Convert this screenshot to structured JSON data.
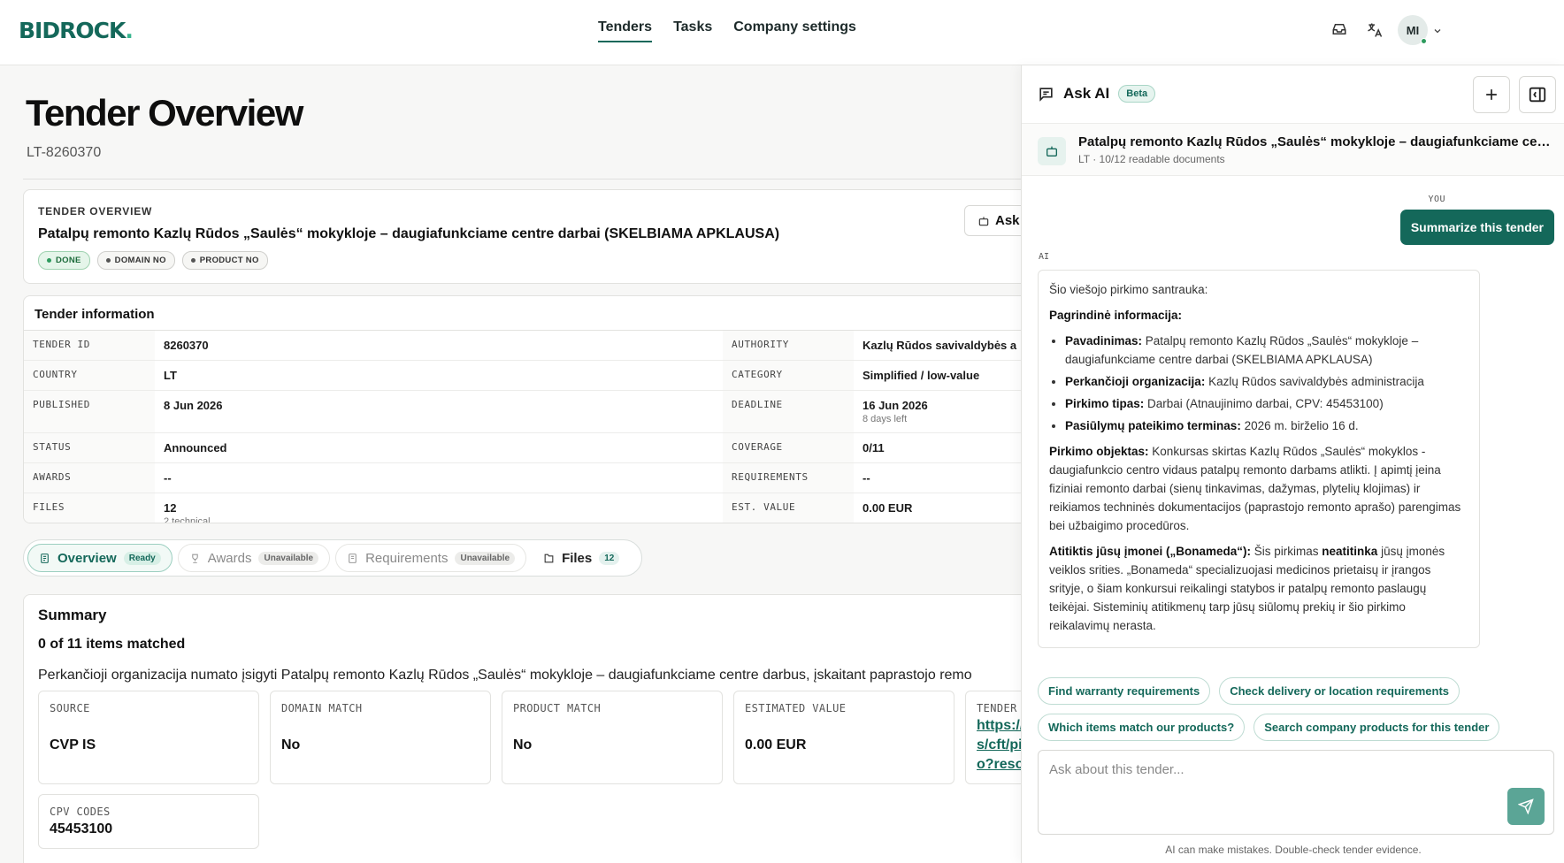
{
  "header": {
    "logo_main": "BIDROCK",
    "logo_dot": ".",
    "nav": [
      "Tenders",
      "Tasks",
      "Company settings"
    ],
    "avatar_initials": "MI"
  },
  "page": {
    "title": "Tender Overview",
    "subtitle": "LT-8260370"
  },
  "overview_card": {
    "eyebrow": "TENDER OVERVIEW",
    "title": "Patalpų remonto Kazlų Rūdos „Saulės“ mokykloje – daugiafunkciame centre darbai (SKELBIAMA APKLAUSA)",
    "badges": [
      "DONE",
      "DOMAIN NO",
      "PRODUCT NO"
    ],
    "ask_button": "Ask"
  },
  "info": {
    "heading": "Tender information",
    "rows": [
      {
        "k1": "TENDER ID",
        "v1": "8260370",
        "s1": "",
        "k2": "AUTHORITY",
        "v2": "Kazlų Rūdos savivaldybės a",
        "s2": ""
      },
      {
        "k1": "COUNTRY",
        "v1": "LT",
        "s1": "",
        "k2": "CATEGORY",
        "v2": "Simplified / low-value",
        "s2": ""
      },
      {
        "k1": "PUBLISHED",
        "v1": "8 Jun 2026",
        "s1": "",
        "k2": "DEADLINE",
        "v2": "16 Jun 2026",
        "s2": "8 days left"
      },
      {
        "k1": "STATUS",
        "v1": "Announced",
        "s1": "",
        "k2": "COVERAGE",
        "v2": "0/11",
        "s2": ""
      },
      {
        "k1": "AWARDS",
        "v1": "--",
        "s1": "",
        "k2": "REQUIREMENTS",
        "v2": "--",
        "s2": ""
      },
      {
        "k1": "FILES",
        "v1": "12",
        "s1": "2 technical",
        "k2": "EST. VALUE",
        "v2": "0.00 EUR",
        "s2": ""
      }
    ]
  },
  "tabs": [
    {
      "label": "Overview",
      "pill": "Ready"
    },
    {
      "label": "Awards",
      "pill": "Unavailable"
    },
    {
      "label": "Requirements",
      "pill": "Unavailable"
    },
    {
      "label": "Files",
      "pill": "12"
    }
  ],
  "summary": {
    "title": "Summary",
    "count": "0 of 11 items matched",
    "description": "Perkančioji organizacija numato įsigyti Patalpų remonto Kazlų Rūdos „Saulės“ mokykloje – daugiafunkciame centre darbus, įskaitant paprastojo remo",
    "cards": [
      {
        "key": "SOURCE",
        "value": "CVP IS"
      },
      {
        "key": "DOMAIN MATCH",
        "value": "No"
      },
      {
        "key": "PRODUCT MATCH",
        "value": "No"
      },
      {
        "key": "ESTIMATED VALUE",
        "value": "0.00 EUR"
      },
      {
        "key": "TENDER",
        "value": "https://\ns/cft/pi\no?reso"
      }
    ],
    "cpv_key": "CPV CODES",
    "cpv_value": "45453100"
  },
  "ai": {
    "title": "Ask AI",
    "beta": "Beta",
    "context_title": "Patalpų remonto Kazlų Rūdos „Saulės“ mokykloje – daugiafunkciame centre darbai (SKELBIAMA APKLAUSA)",
    "context_sub": "LT · 10/12 readable documents",
    "you_label": "YOU",
    "you_message": "Summarize this tender",
    "ai_label": "AI",
    "answer": {
      "intro": "Šio viešojo pirkimo santrauka:",
      "main_heading": "Pagrindinė informacija:",
      "bullets": [
        {
          "b": "Pavadinimas:",
          "t": " Patalpų remonto Kazlų Rūdos „Saulės“ mokykloje – daugiafunkciame centre darbai (SKELBIAMA APKLAUSA)"
        },
        {
          "b": "Perkančioji organizacija:",
          "t": " Kazlų Rūdos savivaldybės administracija"
        },
        {
          "b": "Pirkimo tipas:",
          "t": " Darbai (Atnaujinimo darbai, CPV: 45453100)"
        },
        {
          "b": "Pasiūlymų pateikimo terminas:",
          "t": " 2026 m. birželio 16 d."
        }
      ],
      "object_b": "Pirkimo objektas:",
      "object_t": " Konkursas skirtas Kazlų Rūdos „Saulės“ mokyklos - daugiafunkcio centro vidaus patalpų remonto darbams atlikti. Į apimtį įeina fiziniai remonto darbai (sienų tinkavimas, dažymas, plytelių klojimas) ir reikiamos techninės dokumentacijos (paprastojo remonto aprašo) parengimas bei užbaigimo procedūros.",
      "fit_b": "Atitiktis jūsų įmonei („Bonameda“):",
      "fit_t1": " Šis pirkimas ",
      "fit_b2": "neatitinka",
      "fit_t2": " jūsų įmonės veiklos srities. „Bonameda“ specializuojasi medicinos prietaisų ir įrangos srityje, o šiam konkursui reikalingi statybos ir patalpų remonto paslaugų teikėjai. Sisteminių atitikmenų tarp jūsų siūlomų prekių ir šio pirkimo reikalavimų nerasta."
    },
    "chips": [
      "Find warranty requirements",
      "Check delivery or location requirements",
      "Which items match our products?",
      "Search company products for this tender"
    ],
    "input_placeholder": "Ask about this tender...",
    "disclaimer": "AI can make mistakes. Double-check tender evidence."
  }
}
